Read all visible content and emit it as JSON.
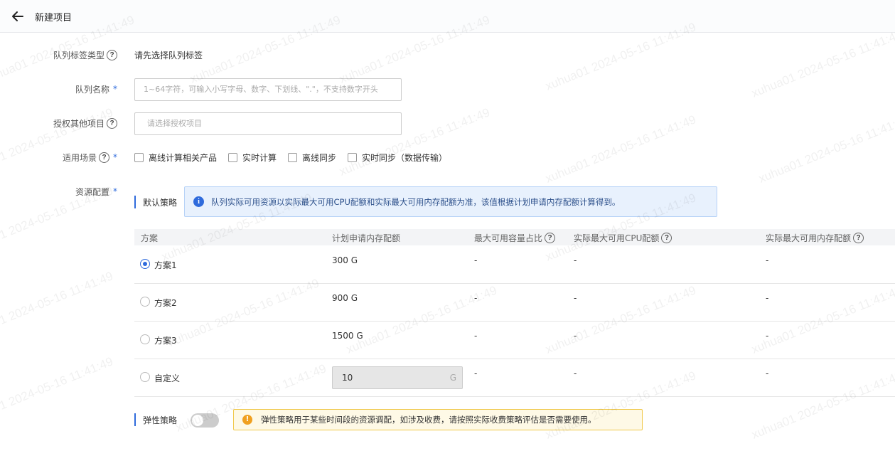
{
  "header": {
    "title": "新建项目"
  },
  "form": {
    "queue_tag_type": {
      "label": "队列标签类型",
      "value": "请先选择队列标签"
    },
    "queue_name": {
      "label": "队列名称",
      "placeholder": "1~64字符，可输入小写字母、数字、下划线、\".\"，不支持数字开头"
    },
    "auth_projects": {
      "label": "授权其他项目",
      "placeholder": "请选择授权项目"
    },
    "scenario": {
      "label": "适用场景",
      "options": [
        "离线计算相关产品",
        "实时计算",
        "离线同步",
        "实时同步（数据传输）"
      ]
    },
    "resource": {
      "label": "资源配置",
      "default_strategy_label": "默认策略",
      "info_text": "队列实际可用资源以实际最大可用CPU配额和实际最大可用内存配额为准，该值根据计划申请内存配额计算得到。",
      "table": {
        "headers": [
          "方案",
          "计划申请内存配额",
          "最大可用容量占比",
          "实际最大可用CPU配额",
          "实际最大可用内存配额"
        ],
        "rows": [
          {
            "name": "方案1",
            "memory": "300 G",
            "ratio": "-",
            "cpu": "-",
            "mem_max": "-",
            "selected": true
          },
          {
            "name": "方案2",
            "memory": "900 G",
            "ratio": "-",
            "cpu": "-",
            "mem_max": "-",
            "selected": false
          },
          {
            "name": "方案3",
            "memory": "1500 G",
            "ratio": "-",
            "cpu": "-",
            "mem_max": "-",
            "selected": false
          },
          {
            "name": "自定义",
            "memory": "10",
            "unit": "G",
            "ratio": "-",
            "cpu": "-",
            "mem_max": "-",
            "selected": false
          }
        ]
      }
    },
    "elastic": {
      "label": "弹性策略",
      "enabled": false,
      "warn_text": "弹性策略用于某些时间段的资源调配，如涉及收费，请按照实际收费策略评估是否需要使用。"
    }
  },
  "watermark": {
    "text": "xuhua01 2024-05-16 11:41:49"
  },
  "colors": {
    "accent": "#2f6bdc",
    "info_bg": "#e8f1fd",
    "warn_bg": "#fef9e6",
    "warn_icon": "#f0a020"
  }
}
